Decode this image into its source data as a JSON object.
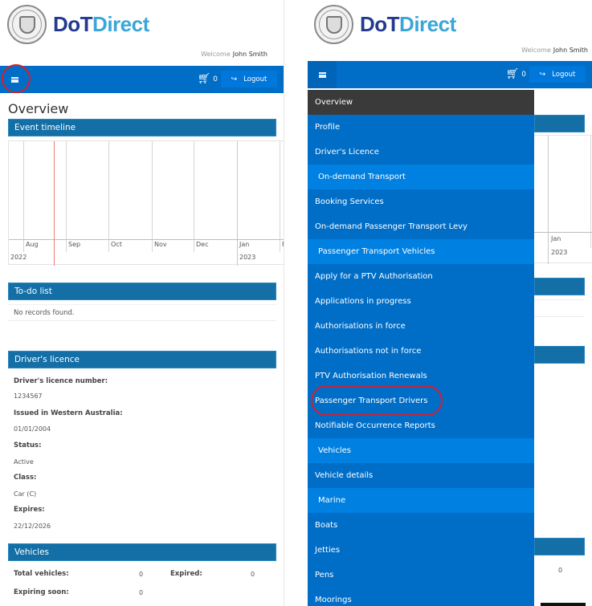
{
  "brand": {
    "part1": "DoT",
    "part2": "Direct",
    "crest_icon": "wa-government-crest-icon"
  },
  "header": {
    "welcome_label": "Welcome",
    "user_name": "John Smith"
  },
  "navbar": {
    "menu_icon": "hamburger-icon",
    "cart_icon": "shopping-cart-icon",
    "cart_count": "0",
    "logout_icon": "logout-icon",
    "logout_label": "Logout"
  },
  "left": {
    "page_title": "Overview",
    "timeline": {
      "title": "Event timeline",
      "months": [
        "Aug",
        "Sep",
        "Oct",
        "Nov",
        "Dec",
        "Jan",
        "F"
      ],
      "years": [
        "2022",
        "2023"
      ],
      "today_marker_color": "#f2766e"
    },
    "todo": {
      "title": "To-do list",
      "empty_text": "No records found."
    },
    "licence": {
      "title": "Driver's licence",
      "fields": [
        {
          "label": "Driver's licence number:",
          "value": "1234567"
        },
        {
          "label": "Issued in Western Australia:",
          "value": "01/01/2004"
        },
        {
          "label": "Status:",
          "value": "Active"
        },
        {
          "label": "Class:",
          "value": "Car (C)"
        },
        {
          "label": "Expires:",
          "value": "22/12/2026"
        }
      ]
    },
    "vehicles": {
      "title": "Vehicles",
      "total_label": "Total vehicles:",
      "total_value": "0",
      "expired_label": "Expired:",
      "expired_value": "0",
      "expiring_label": "Expiring soon:",
      "expiring_value": "0"
    }
  },
  "right": {
    "timeline_months": [
      "Jan"
    ],
    "timeline_years": [
      "2023"
    ],
    "vehicles_value": "0",
    "menu": [
      {
        "label": "Overview",
        "type": "active"
      },
      {
        "label": "Profile",
        "type": "item"
      },
      {
        "label": "Driver's Licence",
        "type": "item"
      },
      {
        "label": "On-demand Transport",
        "type": "group"
      },
      {
        "label": "Booking Services",
        "type": "item"
      },
      {
        "label": "On-demand Passenger Transport Levy",
        "type": "item"
      },
      {
        "label": "Passenger Transport Vehicles",
        "type": "group"
      },
      {
        "label": "Apply for a PTV Authorisation",
        "type": "item"
      },
      {
        "label": "Applications in progress",
        "type": "item"
      },
      {
        "label": "Authorisations in force",
        "type": "item"
      },
      {
        "label": "Authorisations not in force",
        "type": "item"
      },
      {
        "label": "PTV Authorisation Renewals",
        "type": "item"
      },
      {
        "label": "Passenger Transport Drivers",
        "type": "item",
        "highlighted": true
      },
      {
        "label": "Notifiable Occurrence Reports",
        "type": "item"
      },
      {
        "label": "Vehicles",
        "type": "group"
      },
      {
        "label": "Vehicle details",
        "type": "item"
      },
      {
        "label": "Marine",
        "type": "group"
      },
      {
        "label": "Boats",
        "type": "item"
      },
      {
        "label": "Jetties",
        "type": "item"
      },
      {
        "label": "Pens",
        "type": "item"
      },
      {
        "label": "Moorings",
        "type": "item"
      }
    ]
  },
  "colors": {
    "navbar": "#006ec7",
    "section_header": "#136fa6",
    "menu_group": "#0080e0",
    "menu_active": "#3a3a3a",
    "highlight_ring": "#d42030",
    "brand_dark": "#233a8f",
    "brand_light": "#3ba6d8"
  }
}
